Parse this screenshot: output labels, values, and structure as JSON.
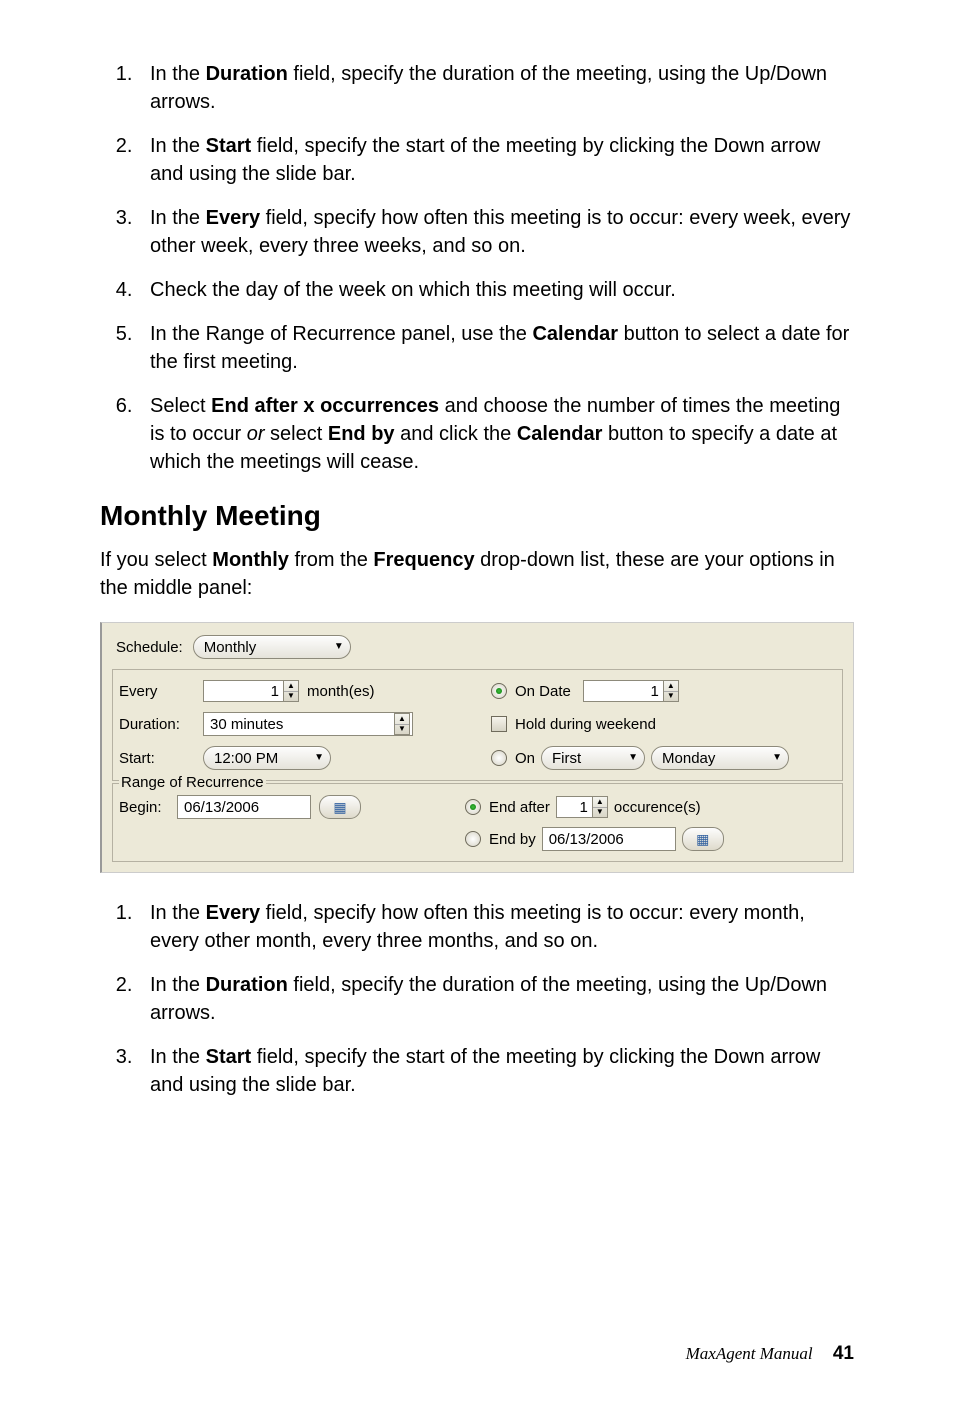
{
  "steps_top": [
    {
      "pre": "In the ",
      "b1": "Duration",
      "post": " field, specify the duration of the meeting, using the Up/Down arrows."
    },
    {
      "pre": "In the ",
      "b1": "Start",
      "post": " field, specify the start of the meeting by clicking the Down arrow and using the slide bar."
    },
    {
      "pre": "In the ",
      "b1": "Every",
      "post": " field, specify how often this meeting is to occur: every week, every other week, every three weeks, and so on."
    },
    {
      "plain": "Check the day of the week on which this meeting will occur."
    },
    {
      "pre": "In the Range of Recurrence panel, use the ",
      "b1": "Calendar",
      "post": " button to select a date for the first meeting."
    },
    {
      "seq": [
        {
          "t": "Select "
        },
        {
          "b": "End after x occurrences"
        },
        {
          "t": " and choose the number of times the meeting is to occur "
        },
        {
          "i": "or"
        },
        {
          "t": " select "
        },
        {
          "b": "End by"
        },
        {
          "t": " and click the "
        },
        {
          "b": "Calendar"
        },
        {
          "t": " button to specify a date at which the meetings will cease."
        }
      ]
    }
  ],
  "section_heading": "Monthly Meeting",
  "intro": {
    "pre": "If you select ",
    "b1": "Monthly",
    "mid": " from the ",
    "b2": "Frequency",
    "post": " drop-down list, these are your options in the middle panel:"
  },
  "panel": {
    "schedule_label": "Schedule:",
    "schedule_value": "Monthly",
    "every_label": "Every",
    "every_value": "1",
    "every_unit": "month(es)",
    "on_date_label": "On Date",
    "on_date_value": "1",
    "duration_label": "Duration:",
    "duration_value": "30 minutes",
    "hold_weekend_label": "Hold during weekend",
    "start_label": "Start:",
    "start_value": "12:00 PM",
    "on_label": "On",
    "on_ordinal": "First",
    "on_day": "Monday",
    "range_title": "Range of Recurrence",
    "begin_label": "Begin:",
    "begin_value": "06/13/2006",
    "end_after_label": "End after",
    "end_after_value": "1",
    "end_after_unit": "occurence(s)",
    "end_by_label": "End by",
    "end_by_value": "06/13/2006"
  },
  "steps_bottom": [
    {
      "pre": "In the ",
      "b1": "Every",
      "post": " field, specify how often this meeting is to occur: every month, every other month, every three months, and so on."
    },
    {
      "pre": "In the ",
      "b1": "Duration",
      "post": " field, specify the duration of the meeting, using the Up/Down arrows."
    },
    {
      "pre": "In the ",
      "b1": "Start",
      "post": " field, specify the start of the meeting by clicking the Down arrow and using the slide bar."
    }
  ],
  "footer": {
    "title": "MaxAgent Manual",
    "page": "41"
  }
}
